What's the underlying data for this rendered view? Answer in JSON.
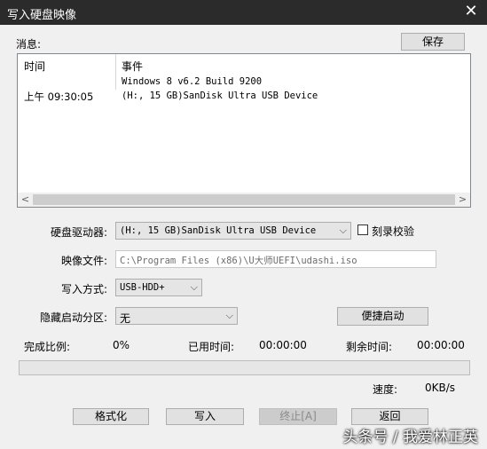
{
  "window": {
    "title": "写入硬盘映像"
  },
  "messages": {
    "label": "消息:",
    "save_label": "保存",
    "col_time": "时间",
    "col_event": "事件",
    "rows": [
      {
        "time": "",
        "event": "Windows 8 v6.2 Build 9200"
      },
      {
        "time": "上午 09:30:05",
        "event": "(H:, 15 GB)SanDisk Ultra USB Device"
      }
    ]
  },
  "form": {
    "drive_label": "硬盘驱动器:",
    "drive_value": "(H:, 15 GB)SanDisk Ultra USB Device",
    "verify_label": "刻录校验",
    "verify_checked": false,
    "image_label": "映像文件:",
    "image_value": "C:\\Program Files (x86)\\U大师UEFI\\udashi.iso",
    "mode_label": "写入方式:",
    "mode_value": "USB-HDD+",
    "hidden_label": "隐藏启动分区:",
    "hidden_value": "无",
    "quick_boot_label": "便捷启动"
  },
  "status": {
    "complete_label": "完成比例:",
    "complete_value": "0%",
    "progress_fraction": 0,
    "used_label": "已用时间:",
    "used_value": "00:00:00",
    "remain_label": "剩余时间:",
    "remain_value": "00:00:00",
    "speed_label": "速度:",
    "speed_value": "0KB/s"
  },
  "buttons": {
    "format": "格式化",
    "write": "写入",
    "stop": "终止[A]",
    "back": "返回"
  },
  "watermark": "头条号 / 我爱林正英"
}
